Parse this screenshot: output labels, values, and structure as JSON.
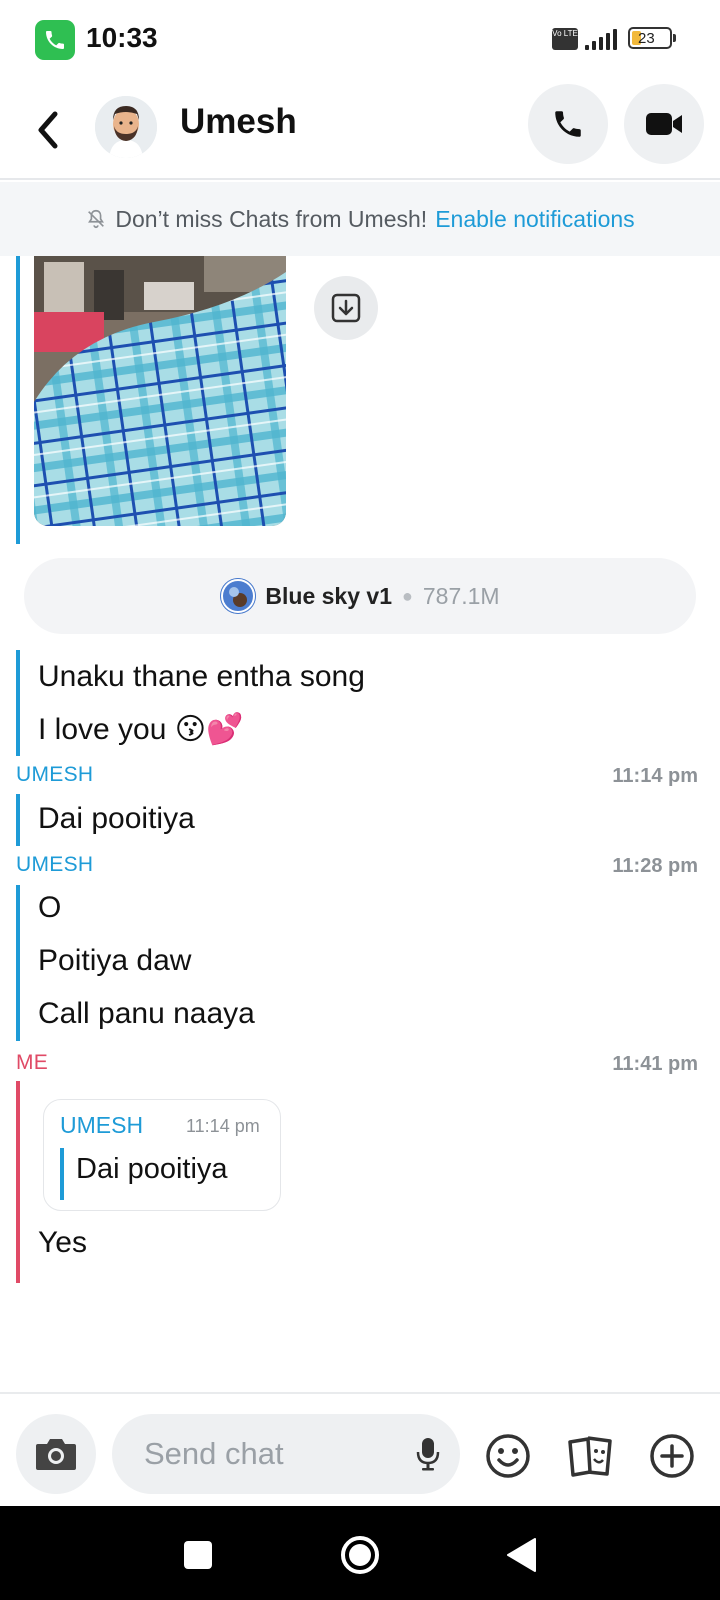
{
  "status_bar": {
    "time": "10:33",
    "network_badge": "Vo LTE",
    "battery_level": "23"
  },
  "header": {
    "contact_name": "Umesh"
  },
  "notification_banner": {
    "text": "Don’t miss Chats from Umesh!",
    "link": "Enable notifications"
  },
  "chat": {
    "sound": {
      "name": "Blue sky v1",
      "count": "787.1M"
    },
    "messages_block_1": [
      "Unaku thane entha song",
      "I love you 😗💕"
    ],
    "group_2": {
      "sender": "UMESH",
      "time": "11:14 pm",
      "messages": [
        "Dai pooitiya"
      ]
    },
    "group_3": {
      "sender": "UMESH",
      "time": "11:28 pm",
      "messages": [
        "O",
        "Poitiya daw",
        "Call panu naaya"
      ]
    },
    "group_4": {
      "sender": "ME",
      "time": "11:41 pm",
      "quote": {
        "sender": "UMESH",
        "time": "11:14 pm",
        "text": "Dai pooitiya"
      },
      "messages": [
        "Yes"
      ]
    }
  },
  "composer": {
    "placeholder": "Send chat"
  },
  "colors": {
    "accent_blue": "#1e9bd7",
    "me_red": "#e04a66",
    "call_green": "#2fbf52"
  }
}
